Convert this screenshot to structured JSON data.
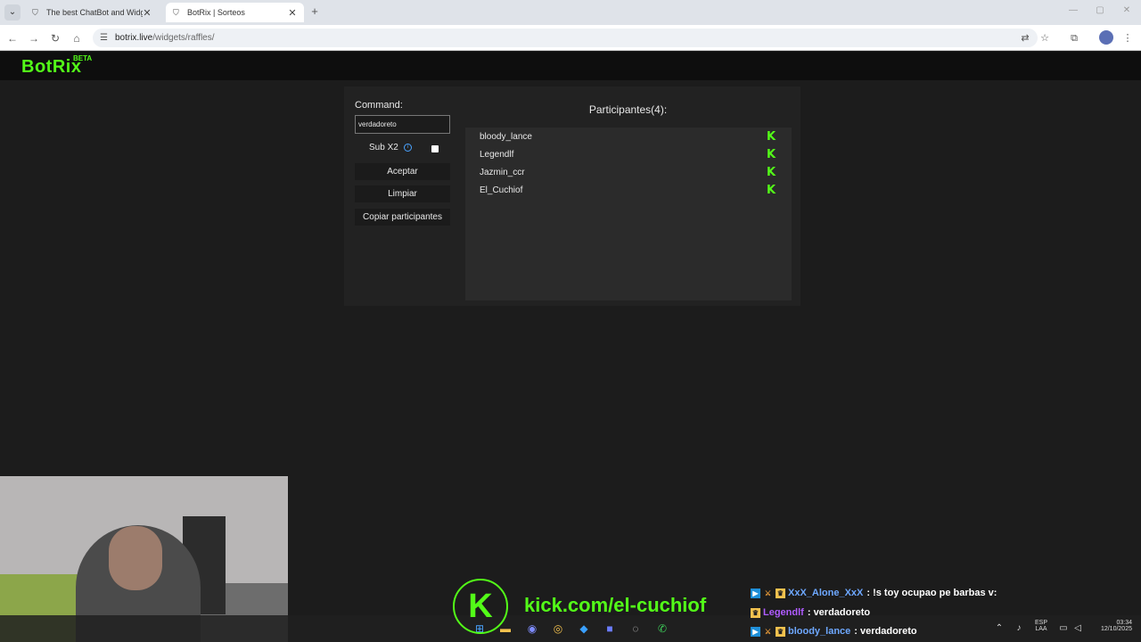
{
  "browser": {
    "tabs": [
      {
        "title": "The best ChatBot and Widgets",
        "active": false
      },
      {
        "title": "BotRix | Sorteos",
        "active": true
      }
    ],
    "url_host": "botrix.live",
    "url_path": "/widgets/raffles/"
  },
  "site": {
    "logo": "BotRix",
    "badge": "BETA"
  },
  "raffle": {
    "command_label": "Command:",
    "command_value": "verdadoreto",
    "sub_label": "Sub X2",
    "sub_checked": false,
    "buttons": {
      "accept": "Aceptar",
      "clear": "Limpiar",
      "copy": "Copiar participantes"
    },
    "participants_title": "Participantes(4):",
    "participants": [
      {
        "name": "bloody_lance",
        "platform": "kick-icon"
      },
      {
        "name": "Legendlf",
        "platform": "kick-icon"
      },
      {
        "name": "Jazmin_ccr",
        "platform": "kick-icon"
      },
      {
        "name": "El_Cuchiof",
        "platform": "kick-icon"
      }
    ]
  },
  "overlay": {
    "kick_url": "kick.com/el-cuchiof",
    "chat": [
      {
        "user": "XxX_Alone_XxX",
        "user_color": "#6ea8ff",
        "message": ": !s toy ocupao pe barbas v:"
      },
      {
        "user": "Legendlf",
        "user_color": "#b05cff",
        "message": ": verdadoreto"
      },
      {
        "user": "bloody_lance",
        "user_color": "#6ea8ff",
        "message": ": verdadoreto"
      }
    ]
  },
  "taskbar": {
    "lang_top": "ESP",
    "lang_bottom": "LAA",
    "time": "03:34",
    "date": "12/10/2025"
  },
  "colors": {
    "kick_green": "#53fc18",
    "panel_bg": "#222222",
    "list_bg": "#2b2b2b"
  }
}
